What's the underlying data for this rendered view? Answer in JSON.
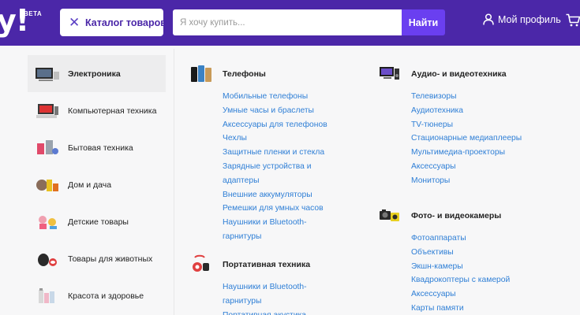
{
  "header": {
    "logo": "y!",
    "beta": "BETA",
    "catalog_label": "Каталог товаров",
    "search_placeholder": "Я хочу купить...",
    "find_label": "Найти",
    "profile_label": "Мой профиль"
  },
  "categories": [
    {
      "label": "Электроника",
      "icon": "tv-icon",
      "active": true
    },
    {
      "label": "Компьютерная техника",
      "icon": "computer-icon",
      "active": false
    },
    {
      "label": "Бытовая техника",
      "icon": "appliance-icon",
      "active": false
    },
    {
      "label": "Дом и дача",
      "icon": "home-garden-icon",
      "active": false
    },
    {
      "label": "Детские товары",
      "icon": "kids-icon",
      "active": false
    },
    {
      "label": "Товары для животных",
      "icon": "pet-icon",
      "active": false
    },
    {
      "label": "Красота и здоровье",
      "icon": "beauty-icon",
      "active": false
    }
  ],
  "sections": {
    "phones": {
      "title": "Телефоны",
      "icon": "phones-icon",
      "links": [
        "Мобильные телефоны",
        "Умные часы и браслеты",
        "Аксессуары для телефонов",
        "Чехлы",
        "Защитные пленки и стекла",
        "Зарядные устройства и адаптеры",
        "Внешние аккумуляторы",
        "Ремешки для умных часов",
        "Наушники и Bluetooth-гарнитуры"
      ]
    },
    "portable": {
      "title": "Портативная техника",
      "icon": "portable-icon",
      "links": [
        "Наушники и Bluetooth-гарнитуры",
        "Портативная акустика"
      ]
    },
    "audio_video": {
      "title": "Аудио- и видеотехника",
      "icon": "audio-video-icon",
      "links": [
        "Телевизоры",
        "Аудиотехника",
        "TV-тюнеры",
        "Стационарные медиаплееры",
        "Мультимедиа-проекторы",
        "Аксессуары",
        "Мониторы"
      ]
    },
    "photo_video": {
      "title": "Фото- и видеокамеры",
      "icon": "camera-icon",
      "links": [
        "Фотоаппараты",
        "Объективы",
        "Экшн-камеры",
        "Квадрокоптеры с камерой",
        "Аксессуары",
        "Карты памяти"
      ]
    }
  }
}
